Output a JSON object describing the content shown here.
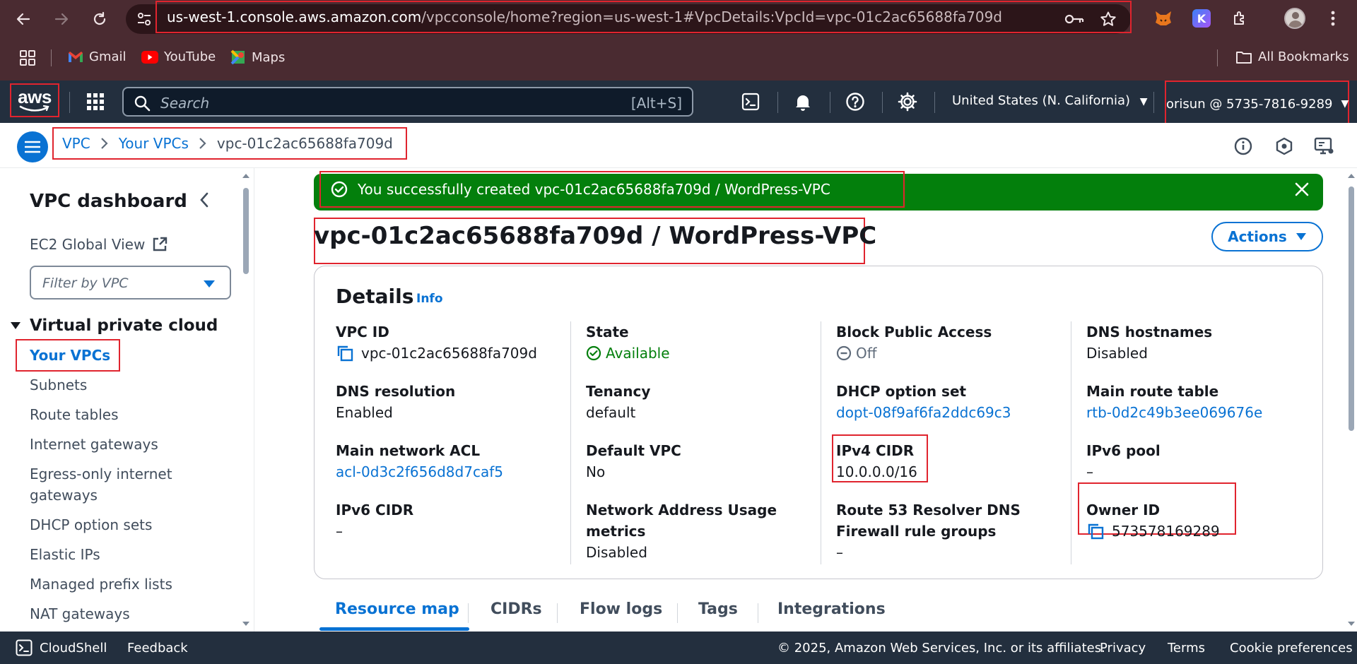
{
  "browser": {
    "url_main": "us-west-1.console.aws.amazon.com",
    "url_rest": "/vpcconsole/home?region=us-west-1#VpcDetails:VpcId=vpc-01c2ac65688fa709d",
    "bookmarks": [
      "Gmail",
      "YouTube",
      "Maps"
    ],
    "all_bookmarks": "All Bookmarks",
    "ext_k_letter": "K"
  },
  "aws_nav": {
    "logo": "aws",
    "search_placeholder": "Search",
    "search_shortcut": "[Alt+S]",
    "region": "United States (N. California)",
    "account": "orisun @ 5735-7816-9289"
  },
  "breadcrumb": {
    "items": [
      "VPC",
      "Your VPCs",
      "vpc-01c2ac65688fa709d"
    ]
  },
  "sidebar": {
    "title": "VPC dashboard",
    "ec2_global_view": "EC2 Global View",
    "filter_placeholder": "Filter by VPC",
    "section": "Virtual private cloud",
    "items": [
      "Your VPCs",
      "Subnets",
      "Route tables",
      "Internet gateways",
      "Egress-only internet",
      "gateways",
      "DHCP option sets",
      "Elastic IPs",
      "Managed prefix lists",
      "NAT gateways"
    ]
  },
  "flash": {
    "message": "You successfully created vpc-01c2ac65688fa709d / WordPress-VPC"
  },
  "page": {
    "title": "vpc-01c2ac65688fa709d / WordPress-VPC",
    "actions_label": "Actions"
  },
  "details": {
    "title": "Details",
    "info": "Info",
    "vpc_id": {
      "label": "VPC ID",
      "value": "vpc-01c2ac65688fa709d"
    },
    "state": {
      "label": "State",
      "value": "Available"
    },
    "block_public_access": {
      "label": "Block Public Access",
      "value": "Off"
    },
    "dns_hostnames": {
      "label": "DNS hostnames",
      "value": "Disabled"
    },
    "dns_resolution": {
      "label": "DNS resolution",
      "value": "Enabled"
    },
    "tenancy": {
      "label": "Tenancy",
      "value": "default"
    },
    "dhcp_option_set": {
      "label": "DHCP option set",
      "value": "dopt-08f9af6fa2ddc69c3"
    },
    "main_route_table": {
      "label": "Main route table",
      "value": "rtb-0d2c49b3ee069676e"
    },
    "main_network_acl": {
      "label": "Main network ACL",
      "value": "acl-0d3c2f656d8d7caf5"
    },
    "default_vpc": {
      "label": "Default VPC",
      "value": "No"
    },
    "ipv4_cidr": {
      "label": "IPv4 CIDR",
      "value": "10.0.0.0/16"
    },
    "ipv6_pool": {
      "label": "IPv6 pool",
      "value": "–"
    },
    "ipv6_cidr": {
      "label": "IPv6 CIDR",
      "value": "–"
    },
    "network_address_usage": {
      "label_line1": "Network Address Usage",
      "label_line2": "metrics",
      "value": "Disabled"
    },
    "route53": {
      "label_line1": "Route 53 Resolver DNS",
      "label_line2": "Firewall rule groups",
      "value": "–"
    },
    "owner_id": {
      "label": "Owner ID",
      "value": "573578169289"
    }
  },
  "tabs": [
    "Resource map",
    "CIDRs",
    "Flow logs",
    "Tags",
    "Integrations"
  ],
  "footer": {
    "cloudshell": "CloudShell",
    "feedback": "Feedback",
    "copyright": "© 2025, Amazon Web Services, Inc. or its affiliates.",
    "privacy": "Privacy",
    "terms": "Terms",
    "cookies": "Cookie preferences"
  },
  "colors": {
    "link": "#0972d3",
    "success": "#037f0c",
    "highlight": "#e0242e",
    "nav_bg": "#232f3e",
    "chrome_bg": "#4a2b31"
  }
}
